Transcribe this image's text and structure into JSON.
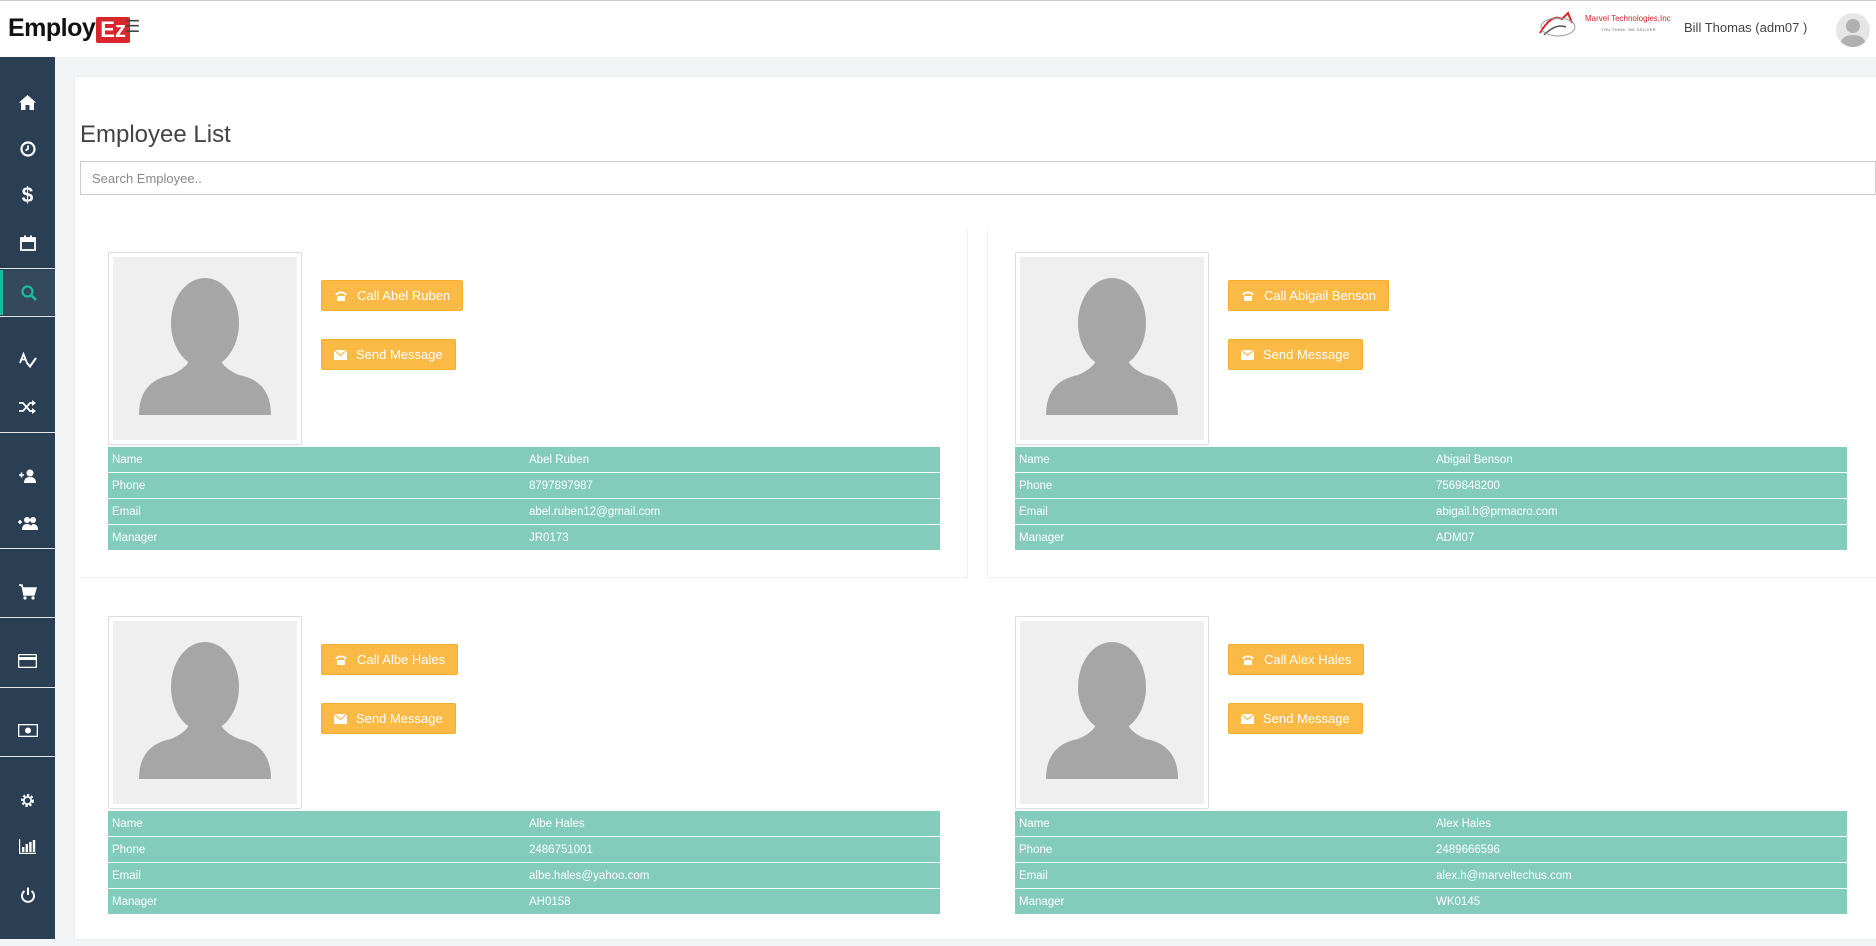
{
  "app": {
    "logo_text": "Employ",
    "logo_badge": "Ez"
  },
  "header": {
    "company_name": "Marvel Technologies,Inc",
    "company_tagline": "YOU THINK. WE DELIVER",
    "user_name": "Bill Thomas (adm07 )"
  },
  "sidebar": {
    "items": [
      {
        "name": "home",
        "icon": "home-icon"
      },
      {
        "name": "time",
        "icon": "clock-icon"
      },
      {
        "name": "payroll",
        "icon": "dollar-icon"
      },
      {
        "name": "calendar",
        "icon": "calendar-icon"
      },
      {
        "name": "search",
        "icon": "search-icon",
        "active": true
      },
      {
        "name": "analytics",
        "icon": "spellcheck-icon"
      },
      {
        "name": "transfer",
        "icon": "shuffle-icon"
      },
      {
        "name": "add-user",
        "icon": "user-plus-icon"
      },
      {
        "name": "add-users",
        "icon": "users-plus-icon"
      },
      {
        "name": "cart",
        "icon": "cart-icon"
      },
      {
        "name": "cards",
        "icon": "credit-card-icon"
      },
      {
        "name": "money",
        "icon": "money-icon"
      },
      {
        "name": "settings",
        "icon": "gear-icon"
      },
      {
        "name": "reports",
        "icon": "bar-chart-icon"
      },
      {
        "name": "logout",
        "icon": "power-icon"
      }
    ]
  },
  "page": {
    "title": "Employee List",
    "search_placeholder": "Search Employee.."
  },
  "colors": {
    "sidebar_bg": "#2a3f54",
    "accent": "#1abb9c",
    "button_bg": "#fbb945",
    "table_bg": "#83ccbc"
  },
  "employees": [
    {
      "call_label": "Call Abel Ruben",
      "message_label": "Send Message",
      "rows": [
        {
          "key": "Name",
          "value": "Abel Ruben"
        },
        {
          "key": "Phone",
          "value": "8797897987"
        },
        {
          "key": "Email",
          "value": "abel.ruben12@gmail.com"
        },
        {
          "key": "Manager",
          "value": "JR0173"
        }
      ]
    },
    {
      "call_label": "Call Abigail Benson",
      "message_label": "Send Message",
      "rows": [
        {
          "key": "Name",
          "value": "Abigail Benson"
        },
        {
          "key": "Phone",
          "value": "7569848200"
        },
        {
          "key": "Email",
          "value": "abigail.b@prmacro.com"
        },
        {
          "key": "Manager",
          "value": "ADM07"
        }
      ]
    },
    {
      "call_label": "Call Albe Hales",
      "message_label": "Send Message",
      "rows": [
        {
          "key": "Name",
          "value": "Albe Hales"
        },
        {
          "key": "Phone",
          "value": "2486751001"
        },
        {
          "key": "Email",
          "value": "albe.hales@yahoo.com"
        },
        {
          "key": "Manager",
          "value": "AH0158"
        }
      ]
    },
    {
      "call_label": "Call Alex Hales",
      "message_label": "Send Message",
      "rows": [
        {
          "key": "Name",
          "value": "Alex Hales"
        },
        {
          "key": "Phone",
          "value": "2489666596"
        },
        {
          "key": "Email",
          "value": "alex.h@marveltechus.com"
        },
        {
          "key": "Manager",
          "value": "WK0145"
        }
      ]
    }
  ]
}
